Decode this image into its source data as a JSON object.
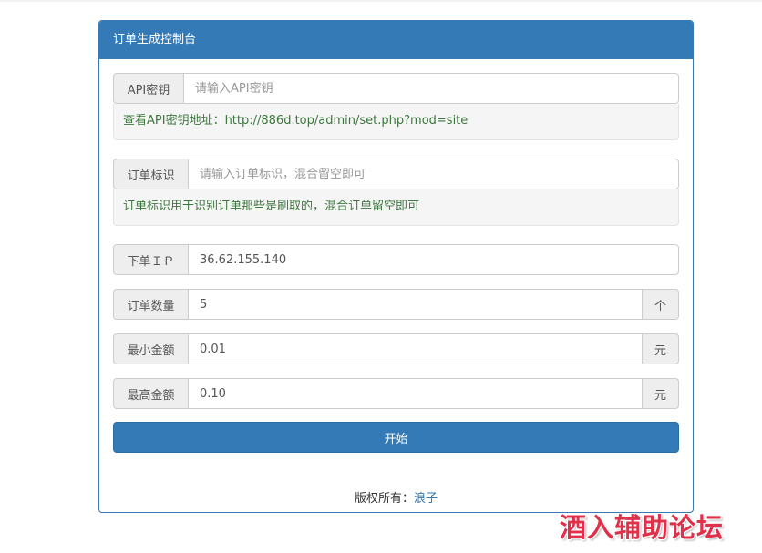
{
  "panel": {
    "title": "订单生成控制台"
  },
  "api_key": {
    "label": "API密钥",
    "placeholder": "请输入API密钥",
    "help": "查看API密钥地址：http://886d.top/admin/set.php?mod=site"
  },
  "order_tag": {
    "label": "订单标识",
    "placeholder": "请输入订单标识，混合留空即可",
    "help": "订单标识用于识别订单那些是刷取的，混合订单留空即可"
  },
  "order_ip": {
    "label": "下单ＩＰ",
    "value": "36.62.155.140"
  },
  "order_count": {
    "label": "订单数量",
    "value": "5",
    "unit": "个"
  },
  "min_amount": {
    "label": "最小金额",
    "value": "0.01",
    "unit": "元"
  },
  "max_amount": {
    "label": "最高金额",
    "value": "0.10",
    "unit": "元"
  },
  "start_button": {
    "label": "开始"
  },
  "footer": {
    "prefix": "版权所有：",
    "author": "浪子"
  },
  "watermark": {
    "text": "酒入辅助论坛"
  },
  "colors": {
    "primary": "#337ab7",
    "help_text": "#3c763d",
    "addon_bg": "#eeeeee",
    "watermark": "#e0304a"
  }
}
